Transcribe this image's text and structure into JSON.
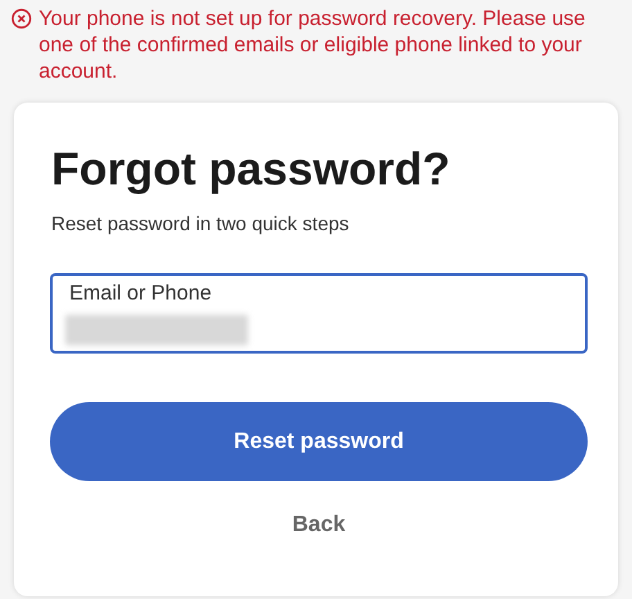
{
  "error": {
    "message": "Your phone is not set up for password recovery. Please use one of the confirmed emails or eligible phone linked to your account."
  },
  "card": {
    "title": "Forgot password?",
    "subtitle": "Reset password in two quick steps",
    "field": {
      "label": "Email or Phone",
      "value_redacted": true
    },
    "primary_button": "Reset password",
    "back_link": "Back"
  }
}
